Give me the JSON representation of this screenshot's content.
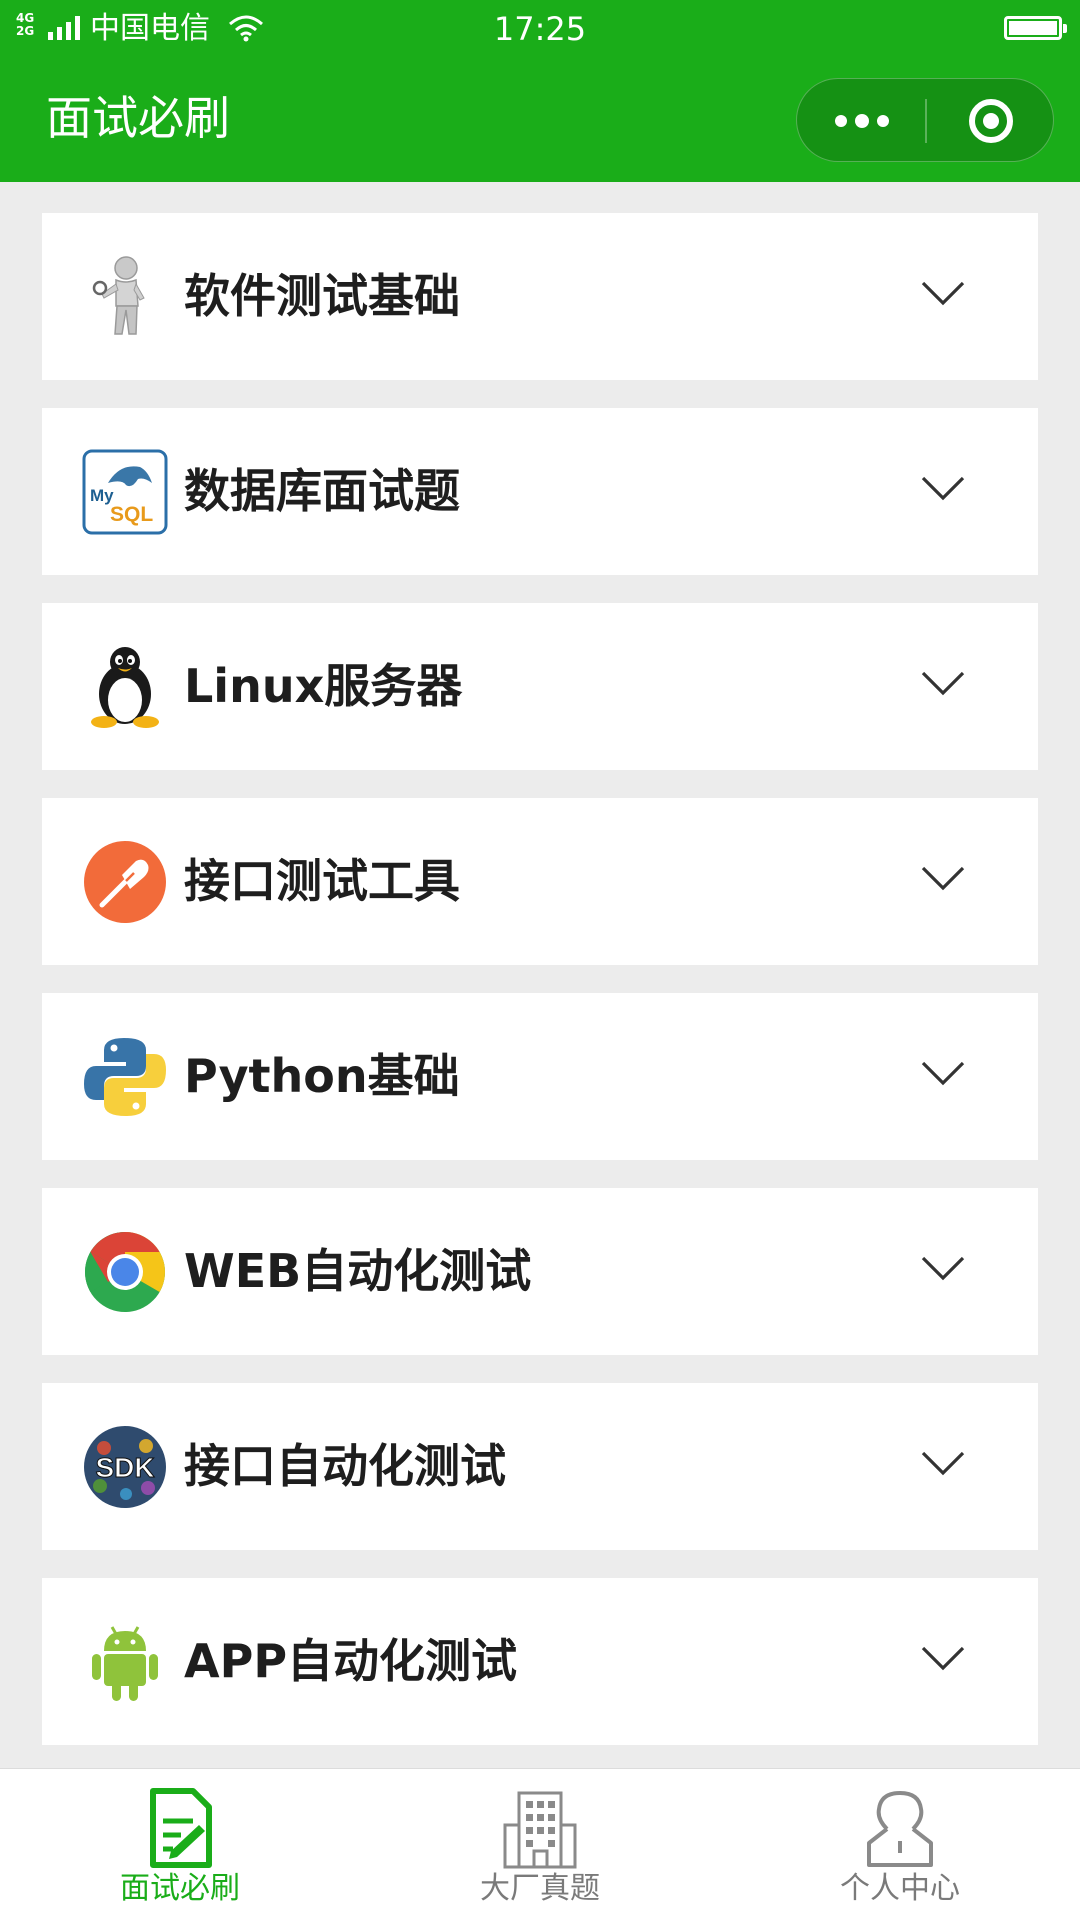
{
  "status_bar": {
    "network": [
      "4G",
      "2G"
    ],
    "carrier": "中国电信",
    "time": "17:25",
    "battery_level": 1.0
  },
  "nav": {
    "title": "面试必刷",
    "capsule_more_icon": "more-dots-icon",
    "capsule_close_icon": "target-close-icon"
  },
  "topics": [
    {
      "label": "软件测试基础",
      "icon": "tester-figure-icon"
    },
    {
      "label": "数据库面试题",
      "icon": "mysql-logo-icon"
    },
    {
      "label": "Linux服务器",
      "icon": "linux-penguin-icon"
    },
    {
      "label": "接口测试工具",
      "icon": "postman-logo-icon"
    },
    {
      "label": "Python基础",
      "icon": "python-logo-icon"
    },
    {
      "label": "WEB自动化测试",
      "icon": "chrome-logo-icon"
    },
    {
      "label": "接口自动化测试",
      "icon": "sdk-logo-icon"
    },
    {
      "label": "APP自动化测试",
      "icon": "android-robot-icon"
    }
  ],
  "tabbar": {
    "items": [
      {
        "label": "面试必刷",
        "icon": "edit-document-icon",
        "active": true
      },
      {
        "label": "大厂真题",
        "icon": "office-building-icon",
        "active": false
      },
      {
        "label": "个人中心",
        "icon": "person-icon",
        "active": false
      }
    ]
  },
  "colors": {
    "brand_green": "#1aad19",
    "page_bg": "#ececec",
    "tab_inactive": "#7a7a7a"
  }
}
